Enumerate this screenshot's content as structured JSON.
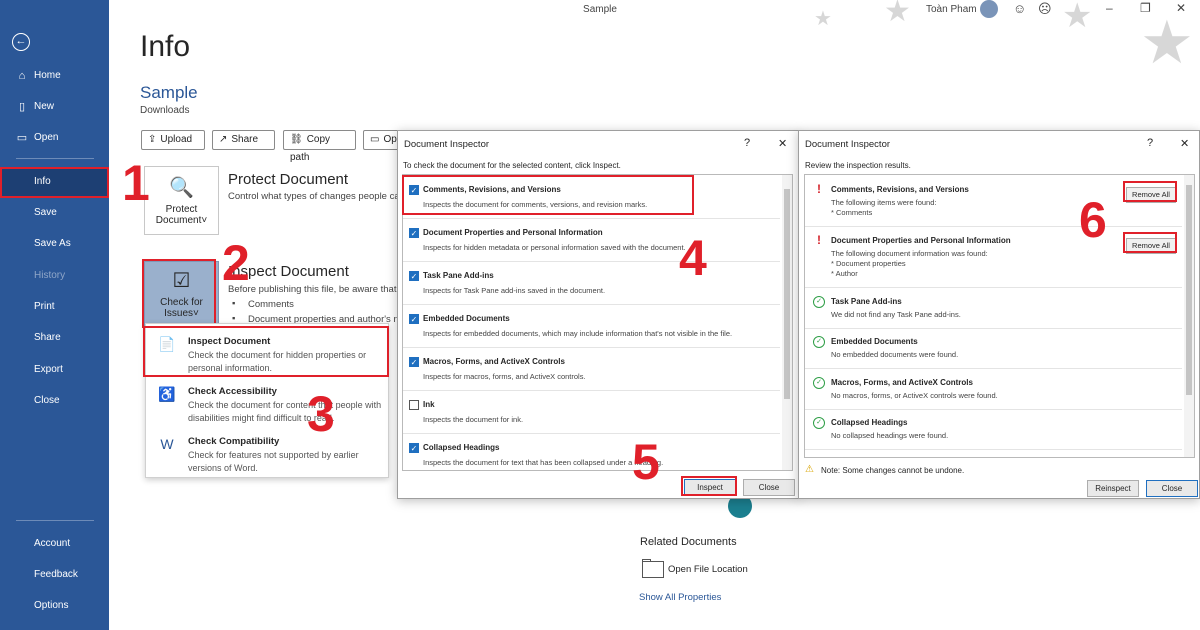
{
  "window": {
    "title": "Sample",
    "user": "Toàn Pham"
  },
  "sidebar": {
    "items": [
      {
        "label": "Home",
        "icon": "home-icon"
      },
      {
        "label": "New",
        "icon": "new-document-icon"
      },
      {
        "label": "Open",
        "icon": "folder-open-icon"
      },
      {
        "label": "Info"
      },
      {
        "label": "Save"
      },
      {
        "label": "Save As"
      },
      {
        "label": "History"
      },
      {
        "label": "Print"
      },
      {
        "label": "Share"
      },
      {
        "label": "Export"
      },
      {
        "label": "Close"
      }
    ],
    "bottom": [
      {
        "label": "Account"
      },
      {
        "label": "Feedback"
      },
      {
        "label": "Options"
      }
    ]
  },
  "main": {
    "title": "Info",
    "doc_name": "Sample",
    "doc_location": "Downloads",
    "actions": {
      "upload": "Upload",
      "share": "Share",
      "copy_path": "Copy path",
      "open_loc": "Op"
    },
    "protect": {
      "button": "Protect Document",
      "button_caret": "˅",
      "title": "Protect Document",
      "desc": "Control what types of changes people ca"
    },
    "inspect": {
      "button": "Check for Issues",
      "button_caret": "˅",
      "title": "Inspect Document",
      "desc": "Before publishing this file, be aware that",
      "bullets": [
        "Comments",
        "Document properties and author's n"
      ]
    },
    "menu": [
      {
        "title": "Inspect Document",
        "desc": "Check the document for hidden properties or personal information."
      },
      {
        "title": "Check Accessibility",
        "desc": "Check the document for content that people with disabilities might find difficult to read."
      },
      {
        "title": "Check Compatibility",
        "desc": "Check for features not supported by earlier versions of Word."
      }
    ],
    "related": {
      "title": "Related Documents",
      "open_location": "Open File Location",
      "show_all": "Show All Properties"
    }
  },
  "steps": [
    "1",
    "2",
    "3",
    "4",
    "5",
    "6"
  ],
  "inspector": {
    "title": "Document Inspector",
    "help": "?",
    "close_x": "✕",
    "subtitle": "To check the document for the selected content, click Inspect.",
    "items": [
      {
        "title": "Comments, Revisions, and Versions",
        "desc": "Inspects the document for comments, versions, and revision marks.",
        "checked": true
      },
      {
        "title": "Document Properties and Personal Information",
        "desc": "Inspects for hidden metadata or personal information saved with the document.",
        "checked": true
      },
      {
        "title": "Task Pane Add-ins",
        "desc": "Inspects for Task Pane add-ins saved in the document.",
        "checked": true
      },
      {
        "title": "Embedded Documents",
        "desc": "Inspects for embedded documents, which may include information that's not visible in the file.",
        "checked": true
      },
      {
        "title": "Macros, Forms, and ActiveX Controls",
        "desc": "Inspects for macros, forms, and ActiveX controls.",
        "checked": true
      },
      {
        "title": "Ink",
        "desc": "Inspects the document for ink.",
        "checked": false
      },
      {
        "title": "Collapsed Headings",
        "desc": "Inspects the document for text that has been collapsed under a heading.",
        "checked": true
      }
    ],
    "inspect_btn": "Inspect",
    "close_btn": "Close"
  },
  "results": {
    "title": "Document Inspector",
    "help": "?",
    "close_x": "✕",
    "subtitle": "Review the inspection results.",
    "items": [
      {
        "status": "warn",
        "title": "Comments, Revisions, and Versions",
        "lines": [
          "The following items were found:",
          "* Comments"
        ],
        "action": "Remove All"
      },
      {
        "status": "warn",
        "title": "Document Properties and Personal Information",
        "lines": [
          "The following document information was found:",
          "* Document properties",
          "* Author"
        ],
        "action": "Remove All"
      },
      {
        "status": "ok",
        "title": "Task Pane Add-ins",
        "lines": [
          "We did not find any Task Pane add-ins."
        ]
      },
      {
        "status": "ok",
        "title": "Embedded Documents",
        "lines": [
          "No embedded documents were found."
        ]
      },
      {
        "status": "ok",
        "title": "Macros, Forms, and ActiveX Controls",
        "lines": [
          "No macros, forms, or ActiveX controls were found."
        ]
      },
      {
        "status": "ok",
        "title": "Collapsed Headings",
        "lines": [
          "No collapsed headings were found."
        ]
      }
    ],
    "note": "Note: Some changes cannot be undone.",
    "reinspect_btn": "Reinspect",
    "close_btn": "Close"
  },
  "colors": {
    "sidebar": "#2b5797",
    "accent_red": "#e0202a",
    "checkbox_blue": "#1f6fc0",
    "ok_green": "#2e9e46"
  }
}
